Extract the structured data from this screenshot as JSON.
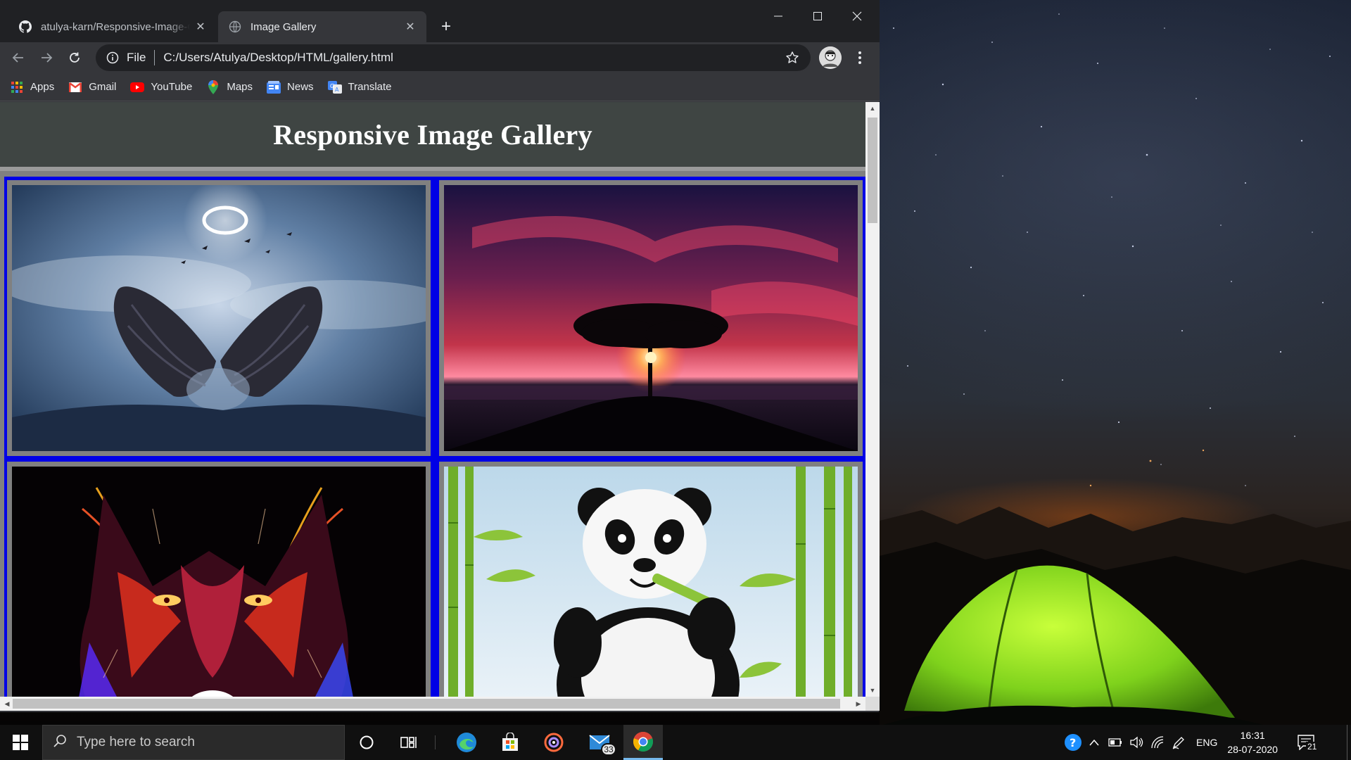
{
  "browser": {
    "tabs": [
      {
        "title": "atulya-karn/Responsive-Image-Gallery",
        "icon": "github-icon",
        "active": false
      },
      {
        "title": "Image Gallery",
        "icon": "globe-icon",
        "active": true
      }
    ],
    "address_bar": {
      "scheme": "File",
      "url": "C:/Users/Atulya/Desktop/HTML/gallery.html"
    },
    "bookmarks": [
      {
        "label": "Apps",
        "icon": "apps-grid-icon"
      },
      {
        "label": "Gmail",
        "icon": "gmail-icon"
      },
      {
        "label": "YouTube",
        "icon": "youtube-icon"
      },
      {
        "label": "Maps",
        "icon": "maps-pin-icon"
      },
      {
        "label": "News",
        "icon": "news-icon"
      },
      {
        "label": "Translate",
        "icon": "translate-icon"
      }
    ]
  },
  "page": {
    "title": "Responsive Image Gallery",
    "images": [
      {
        "subject": "winged-angel-with-halo"
      },
      {
        "subject": "tree-at-red-sunset"
      },
      {
        "subject": "neon-wolf"
      },
      {
        "subject": "panda-with-bamboo"
      }
    ]
  },
  "taskbar": {
    "search_placeholder": "Type here to search",
    "mail_badge": "33",
    "language": "ENG",
    "time": "16:31",
    "date": "28-07-2020",
    "notifications": "21",
    "pinned": [
      "windows-start-icon",
      "cortana-icon",
      "task-view-icon",
      "edge-icon",
      "store-icon",
      "media-player-icon",
      "mail-icon",
      "chrome-icon"
    ]
  },
  "colors": {
    "page_header_bg": "#3f4543",
    "gallery_border_blue": "#0000e6",
    "frame_gray": "#808080"
  }
}
